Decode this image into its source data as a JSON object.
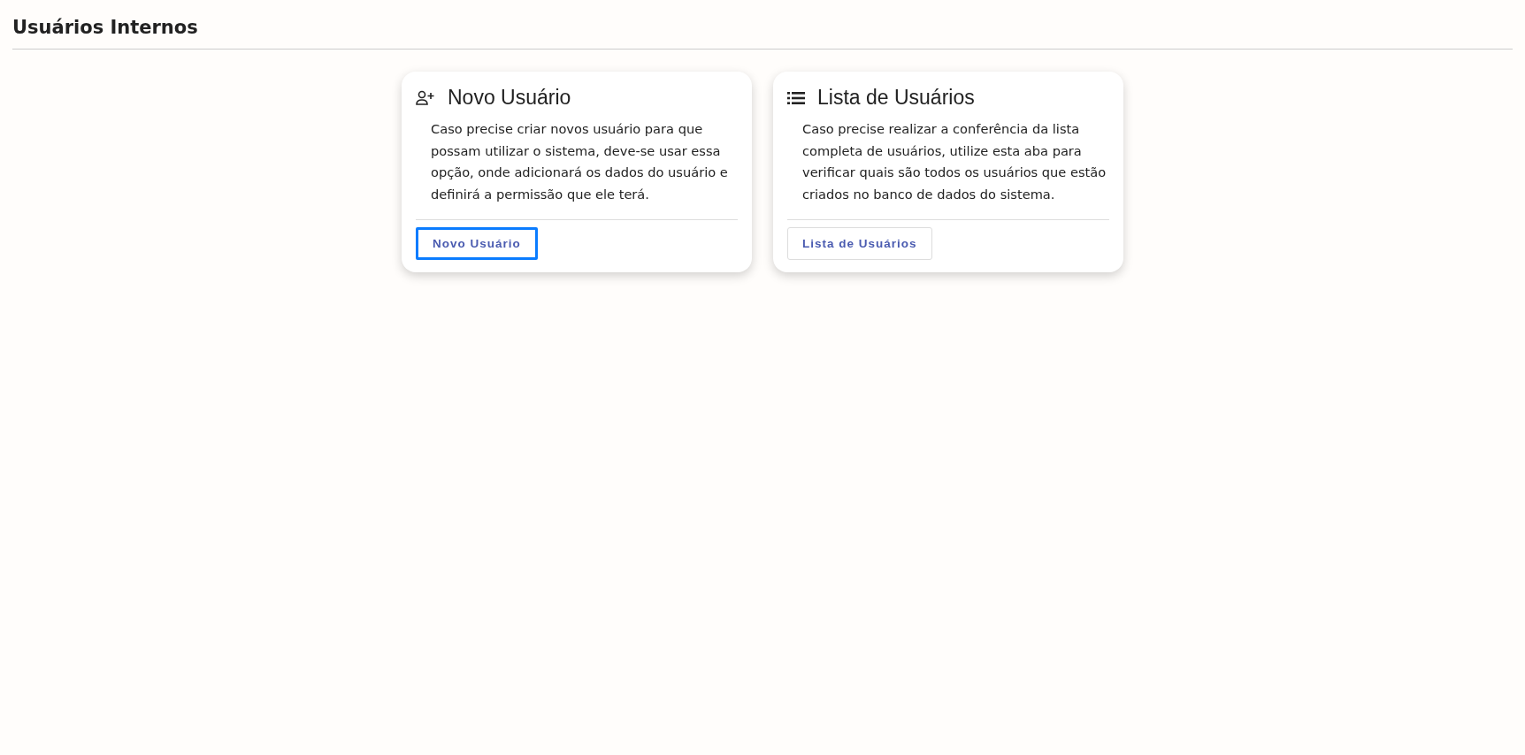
{
  "page": {
    "title": "Usuários Internos"
  },
  "cards": [
    {
      "kind": "add-user",
      "title": "Novo Usuário",
      "description": "Caso precise criar novos usuário para que possam utilizar o sistema, deve-se usar essa opção, onde adicionará os dados do usuário e definirá a permissão que ele terá.",
      "button": {
        "label": "Novo Usuário",
        "focused": true
      }
    },
    {
      "kind": "list",
      "title": "Lista de Usuários",
      "description": "Caso precise realizar a conferência da lista completa de usuários, utilize esta aba para verificar quais são todos os usuários que estão criados no banco de dados do sistema.",
      "button": {
        "label": "Lista de Usuários",
        "focused": false
      }
    }
  ]
}
